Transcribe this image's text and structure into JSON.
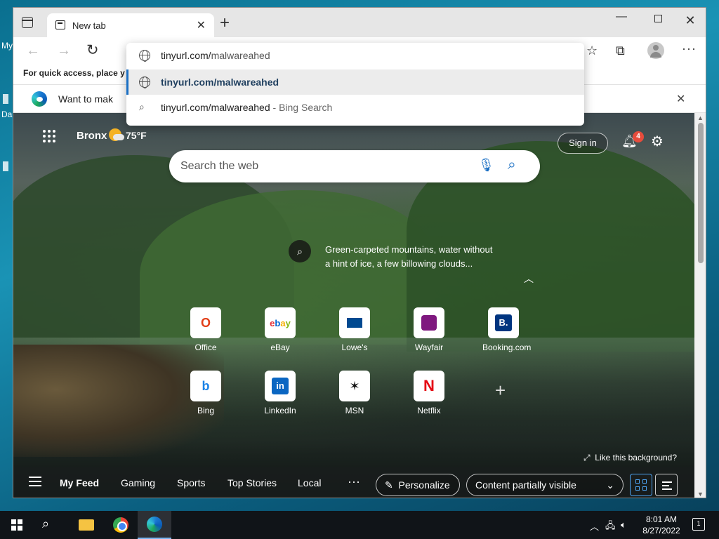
{
  "desktop": {
    "label_1": "My",
    "label_2": "Da"
  },
  "browser": {
    "tab_title": "New tab",
    "favbar_text": "For quick access, place y",
    "infobar_text": "Want to mak",
    "address_dropdown": {
      "typed_host": "tinyurl.com/",
      "typed_path": "malwareahed",
      "selected_suggestion": "tinyurl.com/malwareahed",
      "search_suggestion": "tinyurl.com/malwareahed",
      "search_suffix": " - Bing Search"
    }
  },
  "newtab": {
    "location": "Bronx",
    "temperature": "75°F",
    "sign_in": "Sign in",
    "notification_count": "4",
    "search_placeholder": "Search the web",
    "caption": "Green-carpeted mountains, water without a hint of ice, a few billowing clouds...",
    "like_background": "Like this background?",
    "tiles": [
      {
        "label": "Office",
        "icon": "office-icon",
        "color": "#e2401a"
      },
      {
        "label": "eBay",
        "icon": "ebay-icon",
        "color": "#e53238"
      },
      {
        "label": "Lowe's",
        "icon": "lowes-icon",
        "color": "#004990"
      },
      {
        "label": "Wayfair",
        "icon": "wayfair-icon",
        "color": "#7f187f"
      },
      {
        "label": "Booking.com",
        "icon": "booking-icon",
        "color": "#003580"
      },
      {
        "label": "Bing",
        "icon": "bing-icon",
        "color": "#1a82e6"
      },
      {
        "label": "LinkedIn",
        "icon": "linkedin-icon",
        "color": "#0a66c2"
      },
      {
        "label": "MSN",
        "icon": "msn-icon",
        "color": "#111111"
      },
      {
        "label": "Netflix",
        "icon": "netflix-icon",
        "color": "#e50914"
      }
    ],
    "feed": {
      "items": [
        "My Feed",
        "Gaming",
        "Sports",
        "Top Stories",
        "Local"
      ],
      "personalize": "Personalize",
      "content_visibility": "Content partially visible"
    }
  },
  "taskbar": {
    "time": "8:01 AM",
    "date": "8/27/2022",
    "notifications": "1"
  },
  "colors": {
    "accent": "#1a6fc4",
    "selection_bar": "#1a6fc4",
    "badge": "#e74c3c"
  }
}
